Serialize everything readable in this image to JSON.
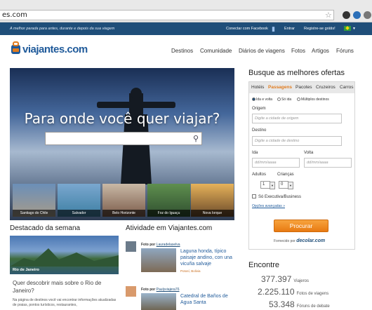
{
  "browser": {
    "url": "es.com",
    "icons": [
      "star-icon",
      "extension-icon-1",
      "extension-icon-2",
      "extension-icon-3"
    ]
  },
  "topbar": {
    "tagline": "A melhor parada para antes, durante e depois da sua viagem",
    "links": [
      "Conectar com Facebook",
      "Entrar",
      "Registre-se grátis!"
    ]
  },
  "logo": {
    "text": "viajantes.com"
  },
  "nav": [
    "Destinos",
    "Comunidade",
    "Diários de viagens",
    "Fotos",
    "Artigos",
    "Fóruns"
  ],
  "hero": {
    "title": "Para onde você quer viajar?",
    "search_value": "",
    "thumbs": [
      "Santiago do Chile",
      "Salvador",
      "Belo Horizonte",
      "Foz do Iguaçu",
      "Nova Iorque"
    ]
  },
  "search_panel": {
    "title": "Busque as melhores ofertas",
    "tabs": [
      "Hotéis",
      "Passagens",
      "Pacotes",
      "Cruzeiros",
      "Carros"
    ],
    "active_tab": "Passagens",
    "trip_types": [
      "Ida e volta",
      "Só ida",
      "Múltiplos destinos"
    ],
    "origin_label": "Origem",
    "origin_placeholder": "Digite a cidade de origem",
    "dest_label": "Destino",
    "dest_placeholder": "Digite a cidade de destino",
    "ida_label": "Ida",
    "volta_label": "Volta",
    "date_placeholder": "dd/mm/aaaa",
    "adults_label": "Adultos",
    "children_label": "Crianças",
    "adults_value": "1",
    "children_value": "0",
    "exec_label": "Só Executiva/Business",
    "advanced": "Opções avançadas »",
    "submit": "Procurar",
    "powered": "Fornecido por",
    "powered_brand": "decolar.com"
  },
  "encontre": {
    "title": "Encontre",
    "stats": [
      {
        "num": "377.397",
        "label": "Viajeros"
      },
      {
        "num": "2.225.110",
        "label": "Fotos de viagens"
      },
      {
        "num": "53.348",
        "label": "Fóruns de debate"
      }
    ]
  },
  "destacado": {
    "title": "Destacado da semana",
    "caption": "Rio de Janeiro",
    "question": "Quer descobrir mais sobre o Rio de Janeiro?",
    "text": "Na página de destinos você vai encontrar informações atualizadas de praias, pontos turísticos, restaurantes,"
  },
  "atividade": {
    "title": "Atividade em Viajantes.com",
    "items": [
      {
        "by": "Foto por",
        "user": "Lauradelaselva",
        "text": "Laguna honda, típico paisaje andino, con una vicuña salvaje",
        "place": "Potosí, Bolivia"
      },
      {
        "by": "Foto por",
        "user": "Paulyviajera76",
        "text": "Catedral de Baños de Agua Santa",
        "place": ""
      }
    ]
  }
}
